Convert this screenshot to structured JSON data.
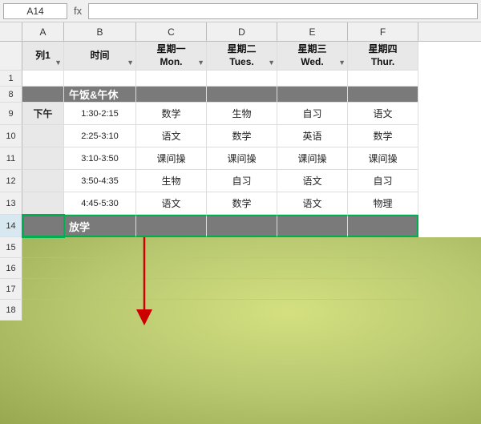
{
  "toolbar": {
    "cell_ref": "A14",
    "formula_icon": "fx"
  },
  "columns": {
    "headers": [
      {
        "id": "A",
        "label": "A",
        "width": "w-col-a"
      },
      {
        "id": "B",
        "label": "B",
        "width": "w-col-b"
      },
      {
        "id": "C",
        "label": "C",
        "width": "w-col-c"
      },
      {
        "id": "D",
        "label": "D",
        "width": "w-col-d"
      },
      {
        "id": "E",
        "label": "E",
        "width": "w-col-e"
      },
      {
        "id": "F",
        "label": "F",
        "width": "w-col-f"
      }
    ]
  },
  "rows": {
    "header_row": {
      "row_num": "",
      "col_a": "列1",
      "col_b": "时间",
      "col_c_line1": "星期一",
      "col_c_line2": "Mon.",
      "col_d_line1": "星期二",
      "col_d_line2": "Tues.",
      "col_e_line1": "星期三",
      "col_e_line2": "Wed.",
      "col_f_line1": "星期四",
      "col_f_line2": "Thur."
    },
    "row1": {
      "num": "1",
      "merged_label": ""
    },
    "row8": {
      "num": "8",
      "merged_label": "午饭&午休"
    },
    "row9": {
      "num": "9",
      "label": "下午",
      "time": "1:30-2:15",
      "mon": "数学",
      "tue": "生物",
      "wed": "自习",
      "thu": "语文"
    },
    "row10": {
      "num": "10",
      "label": "",
      "time": "2:25-3:10",
      "mon": "语文",
      "tue": "数学",
      "wed": "英语",
      "thu": "数学"
    },
    "row11": {
      "num": "11",
      "label": "",
      "time": "3:10-3:50",
      "mon": "课间操",
      "tue": "课间操",
      "wed": "课间操",
      "thu": "课间操"
    },
    "row12": {
      "num": "12",
      "label": "",
      "time": "3:50-4:35",
      "mon": "生物",
      "tue": "自习",
      "wed": "语文",
      "thu": "自习"
    },
    "row13": {
      "num": "13",
      "label": "",
      "time": "4:45-5:30",
      "mon": "语文",
      "tue": "数学",
      "wed": "语文",
      "thu": "物理"
    },
    "row14": {
      "num": "14",
      "merged_label": "放学"
    },
    "row15": {
      "num": "15"
    },
    "row16": {
      "num": "16"
    },
    "row17": {
      "num": "17"
    },
    "row18": {
      "num": "18"
    }
  },
  "colors": {
    "header_bg": "#e8e8e8",
    "dark_row_bg": "#7a7a7a",
    "selected_green": "#00b050",
    "bottom_bg": "#c8d488"
  }
}
